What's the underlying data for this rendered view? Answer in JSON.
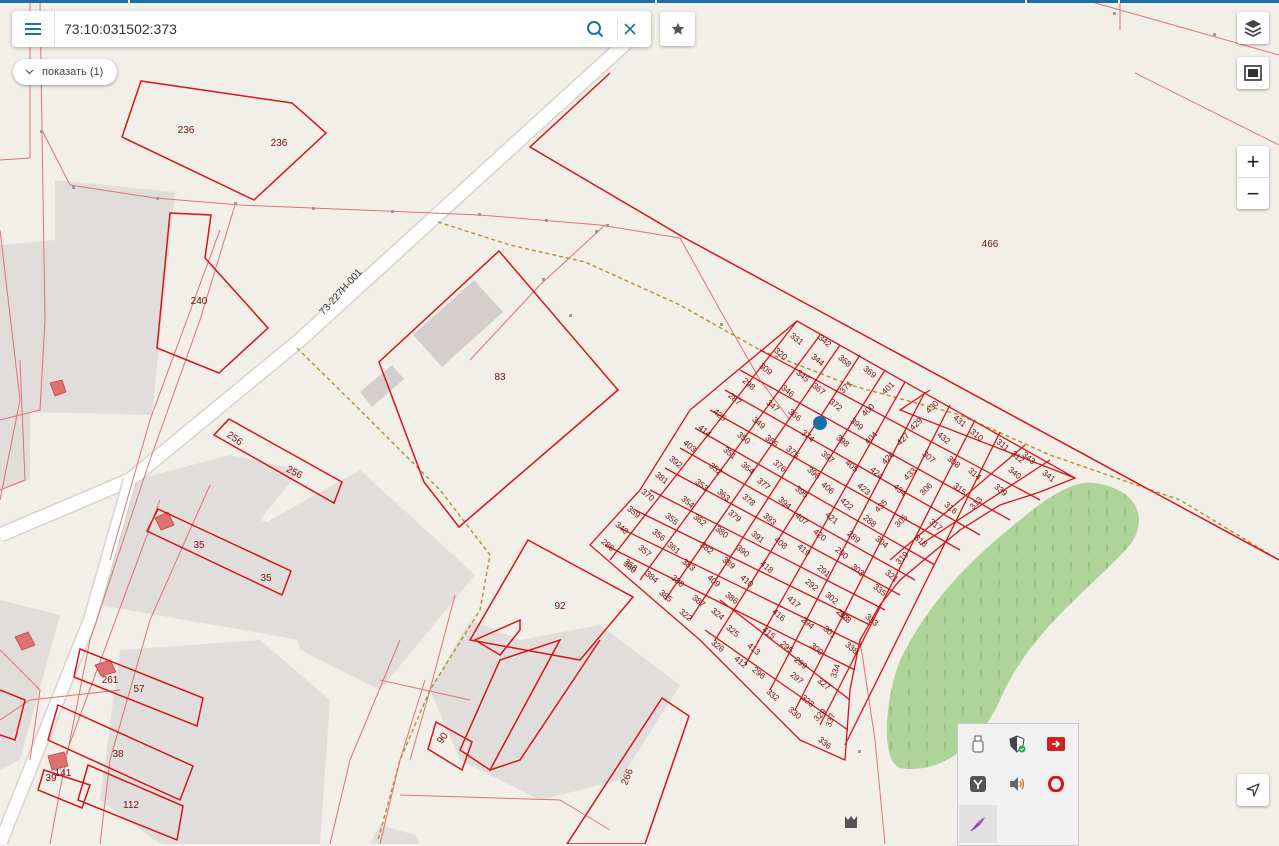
{
  "search": {
    "value": "73:10:031502:373",
    "placeholder": ""
  },
  "show_button": {
    "label": "показать (1)"
  },
  "road_label": "73-227Н-001",
  "parcel_labels": [
    "236",
    "236",
    "240",
    "83",
    "466",
    "256",
    "256",
    "35",
    "35",
    "92",
    "261",
    "57",
    "38",
    "141",
    "39",
    "112",
    "90",
    "266"
  ],
  "plot_grid_labels": [
    "331",
    "342",
    "320",
    "344",
    "368",
    "309",
    "345",
    "369",
    "298",
    "346",
    "367",
    "371",
    "401",
    "287",
    "347",
    "372",
    "400",
    "425",
    "349",
    "366",
    "399",
    "414",
    "350",
    "365",
    "374",
    "398",
    "404",
    "403",
    "351",
    "375",
    "397",
    "405",
    "427",
    "392",
    "352",
    "364",
    "376",
    "396",
    "406",
    "424",
    "426",
    "381",
    "353",
    "363",
    "377",
    "395",
    "422",
    "423",
    "434",
    "433",
    "370",
    "354",
    "378",
    "394",
    "421",
    "288",
    "435",
    "306",
    "359",
    "355",
    "362",
    "379",
    "393",
    "407",
    "420",
    "289",
    "304",
    "305",
    "348",
    "356",
    "361",
    "382",
    "380",
    "391",
    "408",
    "290",
    "303",
    "286",
    "357",
    "383",
    "389",
    "390",
    "419",
    "291",
    "302",
    "360",
    "384",
    "388",
    "409",
    "418",
    "292",
    "323",
    "358",
    "385",
    "387",
    "410",
    "417",
    "293",
    "322",
    "386",
    "416",
    "294",
    "301",
    "324",
    "415",
    "295",
    "300",
    "325",
    "413",
    "296",
    "299",
    "326",
    "412",
    "297",
    "327",
    "332",
    "328",
    "330",
    "329",
    "336",
    "337",
    "338",
    "334",
    "333",
    "335",
    "321",
    "319",
    "318",
    "317",
    "316",
    "315",
    "314",
    "313",
    "339",
    "340",
    "341",
    "343",
    "312",
    "311",
    "310",
    "308",
    "307",
    "432",
    "431",
    "430",
    "429",
    "428"
  ],
  "colors": {
    "parcel_stroke": "#d9141b",
    "label": "#7a1010",
    "road": "#ffffff",
    "building": "#d8d4d1",
    "green": "#aed49a",
    "marker": "#1b6fa8",
    "accent": "#1b6fa8"
  },
  "icons": {
    "menu": "hamburger-menu-icon",
    "search": "search-icon",
    "clear": "close-icon",
    "favorite": "star-icon",
    "layers": "layers-icon",
    "fullscreen": "fullscreen-icon",
    "locate": "navigation-arrow-icon",
    "tray": [
      "usb-drive-icon",
      "shield-check-icon",
      "red-arrow-app-icon",
      "yandex-icon",
      "speaker-icon",
      "opera-icon",
      "feather-pen-icon"
    ]
  }
}
